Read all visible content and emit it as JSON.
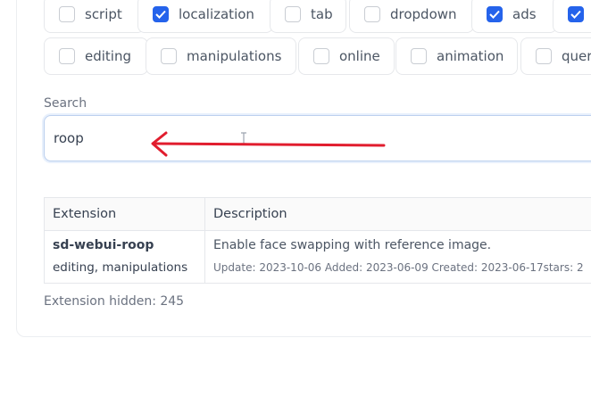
{
  "tags_row1": [
    {
      "label": "script",
      "checked": false
    },
    {
      "label": "localization",
      "checked": true
    },
    {
      "label": "tab",
      "checked": false
    },
    {
      "label": "dropdown",
      "checked": false
    },
    {
      "label": "ads",
      "checked": true
    },
    {
      "label": "",
      "checked": true
    }
  ],
  "tags_row2": [
    {
      "label": "editing",
      "checked": false
    },
    {
      "label": "manipulations",
      "checked": false
    },
    {
      "label": "online",
      "checked": false
    },
    {
      "label": "animation",
      "checked": false
    },
    {
      "label": "quer",
      "checked": false
    }
  ],
  "search": {
    "label": "Search",
    "value": "roop"
  },
  "table": {
    "headers": [
      "Extension",
      "Description"
    ],
    "rows": [
      {
        "name": "sd-webui-roop",
        "tags": "editing, manipulations",
        "description": "Enable face swapping with reference image.",
        "meta": "Update: 2023-10-06 Added: 2023-06-09 Created: 2023-06-17stars: 2"
      }
    ]
  },
  "hidden_count": "Extension hidden: 245",
  "colors": {
    "accent": "#2563eb",
    "annotation_arrow": "#e11d2e"
  },
  "icons": [
    "checkbox-icon",
    "check-icon",
    "text-cursor-icon",
    "arrow-left-icon"
  ]
}
